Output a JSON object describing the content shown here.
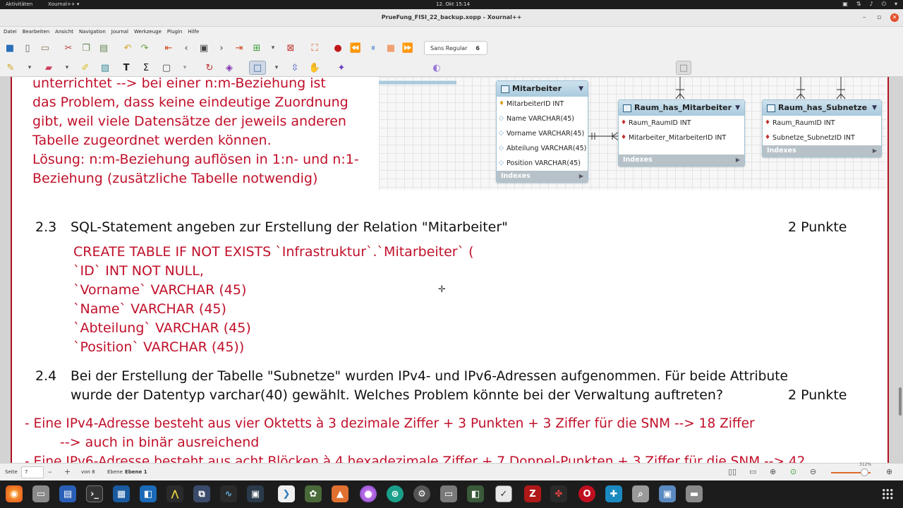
{
  "topbar": {
    "activities": "Aktivitäten",
    "app": "Xournal++ ▾",
    "clock": "12. Okt  15:14"
  },
  "window": {
    "title": "PrueFung_FISI_22_backup.xopp - Xournal++"
  },
  "menu": [
    "Datei",
    "Bearbeiten",
    "Ansicht",
    "Navigation",
    "Journal",
    "Werkzeuge",
    "Plugin",
    "Hilfe"
  ],
  "toolbar": {
    "font_name": "Sans Regular",
    "font_size": "6"
  },
  "colors": {
    "palette": [
      "#444444",
      "#3aa64a",
      "#5ad0f0",
      "#5ad060",
      "#8a7ad8",
      "#9c9c9c",
      "#e05050",
      "#e050e0",
      "#f0a050",
      "#f0f060",
      "#ffffff"
    ],
    "ink_red": "#c0102a"
  },
  "note_top": {
    "lines": [
      "unterrichtet --> bei einer n:m-Beziehung ist",
      "das Problem, dass keine eindeutige Zuordnung",
      "gibt, weil viele Datensätze der jeweils anderen",
      "Tabelle zugeordnet werden können.",
      "Lösung: n:m-Beziehung auflösen in 1:n- und n:1-",
      "Beziehung (zusätzliche Tabelle notwendig)"
    ]
  },
  "er": {
    "mitarbeiter": {
      "title": "Mitarbeiter",
      "rows": [
        "MitarbeiterID INT",
        "Name VARCHAR(45)",
        "Vorname VARCHAR(45)",
        "Abteilung VARCHAR(45)",
        "Position VARCHAR(45)"
      ],
      "footer": "Indexes"
    },
    "raum_has_mitarbeiter": {
      "title": "Raum_has_Mitarbeiter",
      "rows": [
        "Raum_RaumID INT",
        "Mitarbeiter_MitarbeiterID INT"
      ],
      "footer": "Indexes"
    },
    "raum_has_subnetze": {
      "title": "Raum_has_Subnetze",
      "rows": [
        "Raum_RaumID INT",
        "Subnetze_SubnetzID INT"
      ],
      "footer": "Indexes"
    }
  },
  "q23": {
    "num": "2.3",
    "text": "SQL-Statement angeben zur Erstellung der Relation \"Mitarbeiter\"",
    "points": "2 Punkte"
  },
  "sql": {
    "lines": [
      "CREATE TABLE IF NOT EXISTS `Infrastruktur`.`Mitarbeiter` (",
      "`ID` INT NOT NULL,",
      "`Vorname` VARCHAR (45)",
      "`Name` VARCHAR (45)",
      "`Abteilung` VARCHAR (45)",
      "`Position` VARCHAR (45))"
    ]
  },
  "q24": {
    "num": "2.4",
    "line1": "Bei der Erstellung der Tabelle \"Subnetze\" wurden IPv4- und IPv6-Adressen aufgenommen. Für beide Attribute",
    "line2": "wurde der Datentyp varchar(40) gewählt. Welches Problem könnte bei der Verwaltung auftreten?",
    "points": "2 Punkte"
  },
  "answer": {
    "line1": "- Eine IPv4-Adresse besteht aus vier Oktetts à 3 dezimale Ziffer + 3 Punkten + 3 Ziffer für die SNM --> 18 Ziffer",
    "line2": "--> auch in binär ausreichend",
    "line3": "- Eine IPv6-Adresse besteht aus acht Blöcken à 4 hexadezimale Ziffer + 7 Doppel-Punkten + 3 Ziffer für die SNM --> 42"
  },
  "status": {
    "page_label": "Seite",
    "page_value": "7",
    "page_of": "von 8",
    "layer_label": "Ebene",
    "layer_value": "Ebene 1",
    "zoom": "312%"
  }
}
